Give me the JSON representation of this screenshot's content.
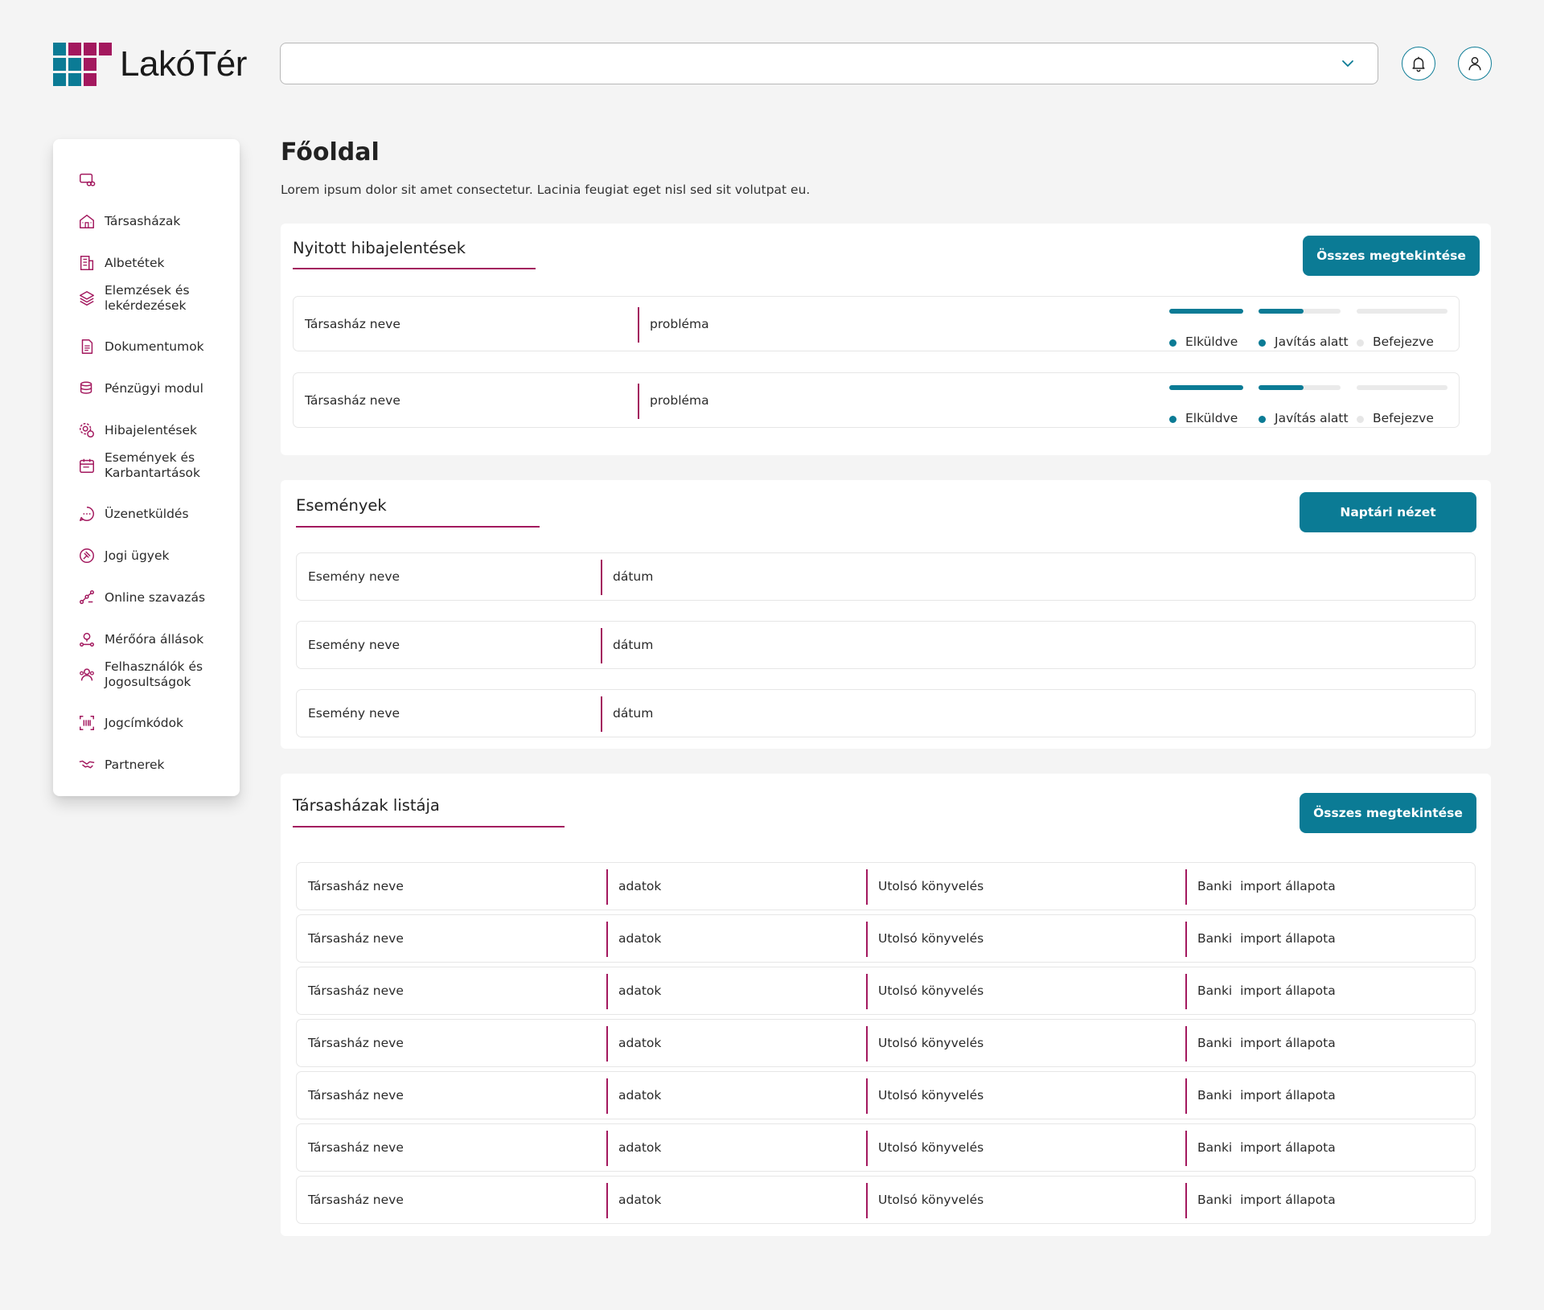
{
  "brand": {
    "name": "LakóTér",
    "accent": "#a3185e",
    "primary": "#0b7b95"
  },
  "header": {
    "select_value": ""
  },
  "sidebar": {
    "items": [
      {
        "label": "",
        "icon": "car-icon"
      },
      {
        "label": "Társasházak",
        "icon": "buildings-icon"
      },
      {
        "label": "Albetétek",
        "icon": "building-icon"
      },
      {
        "label": "Elemzések és lekérdezések",
        "icon": "layers-icon"
      },
      {
        "label": "Dokumentumok",
        "icon": "document-icon"
      },
      {
        "label": "Pénzügyi modul",
        "icon": "coins-icon"
      },
      {
        "label": "Hibajelentések",
        "icon": "gear-warning-icon"
      },
      {
        "label": "Események és Karbantartások",
        "icon": "calendar-icon"
      },
      {
        "label": "Üzenetküldés",
        "icon": "chat-icon"
      },
      {
        "label": "Jogi ügyek",
        "icon": "gavel-icon"
      },
      {
        "label": "Online szavazás",
        "icon": "vote-icon"
      },
      {
        "label": "Mérőóra állások",
        "icon": "meter-icon"
      },
      {
        "label": "Felhasználók és Jogosultságok",
        "icon": "users-icon"
      },
      {
        "label": "Jogcímkódok",
        "icon": "barcode-icon"
      },
      {
        "label": "Partnerek",
        "icon": "handshake-icon"
      }
    ]
  },
  "page": {
    "title": "Főoldal",
    "description": "Lorem ipsum dolor sit amet consectetur. Lacinia feugiat eget nisl sed sit volutpat eu."
  },
  "reports": {
    "title": "Nyitott hibajelentések",
    "button": "Összes megtekintése",
    "status_labels": [
      "Elküldve",
      "Javítás alatt",
      "Befejezve"
    ],
    "rows": [
      {
        "name": "Társasház neve",
        "problem": "probléma",
        "progress": [
          1.0,
          0.55,
          0.0
        ]
      },
      {
        "name": "Társasház neve",
        "problem": "probléma",
        "progress": [
          1.0,
          0.55,
          0.0
        ]
      }
    ]
  },
  "events": {
    "title": "Események",
    "button": "Naptári nézet",
    "rows": [
      {
        "name": "Esemény neve",
        "date": "dátum"
      },
      {
        "name": "Esemény neve",
        "date": "dátum"
      },
      {
        "name": "Esemény neve",
        "date": "dátum"
      }
    ]
  },
  "houses": {
    "title": "Társasházak listája",
    "button": "Összes megtekintése",
    "rows": [
      {
        "name": "Társasház neve",
        "data": "adatok",
        "last": "Utolsó könyvelés",
        "bank": "Banki  import állapota"
      },
      {
        "name": "Társasház neve",
        "data": "adatok",
        "last": "Utolsó könyvelés",
        "bank": "Banki  import állapota"
      },
      {
        "name": "Társasház neve",
        "data": "adatok",
        "last": "Utolsó könyvelés",
        "bank": "Banki  import állapota"
      },
      {
        "name": "Társasház neve",
        "data": "adatok",
        "last": "Utolsó könyvelés",
        "bank": "Banki  import állapota"
      },
      {
        "name": "Társasház neve",
        "data": "adatok",
        "last": "Utolsó könyvelés",
        "bank": "Banki  import állapota"
      },
      {
        "name": "Társasház neve",
        "data": "adatok",
        "last": "Utolsó könyvelés",
        "bank": "Banki  import állapota"
      },
      {
        "name": "Társasház neve",
        "data": "adatok",
        "last": "Utolsó könyvelés",
        "bank": "Banki  import állapota"
      }
    ]
  }
}
